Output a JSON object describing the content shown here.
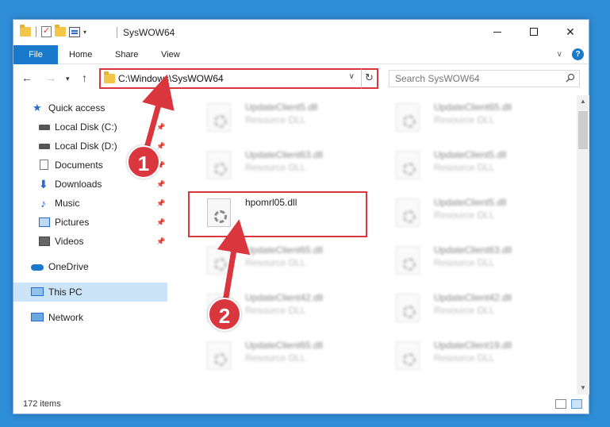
{
  "window": {
    "title": "SysWOW64"
  },
  "ribbon": {
    "tabs": [
      "File",
      "Home",
      "Share",
      "View"
    ],
    "help_label": "?"
  },
  "nav": {
    "address": "C:\\Windows\\SysWOW64",
    "search_placeholder": "Search SysWOW64"
  },
  "sidebar": {
    "items": [
      {
        "label": "Quick access",
        "icon": "star-icon"
      },
      {
        "label": "Local Disk (C:)",
        "icon": "drive-icon",
        "pinned": true
      },
      {
        "label": "Local Disk (D:)",
        "icon": "drive-icon",
        "pinned": true
      },
      {
        "label": "Documents",
        "icon": "documents-icon",
        "pinned": true
      },
      {
        "label": "Downloads",
        "icon": "download-icon",
        "pinned": true
      },
      {
        "label": "Music",
        "icon": "music-icon",
        "pinned": true
      },
      {
        "label": "Pictures",
        "icon": "pictures-icon",
        "pinned": true
      },
      {
        "label": "Videos",
        "icon": "videos-icon",
        "pinned": true
      },
      {
        "label": "OneDrive",
        "icon": "cloud-icon"
      },
      {
        "label": "This PC",
        "icon": "computer-icon",
        "selected": true
      },
      {
        "label": "Network",
        "icon": "network-icon"
      }
    ]
  },
  "files": [
    {
      "name": "UpdateClient5.dll",
      "type": "Resource DLL"
    },
    {
      "name": "UpdateClient65.dll",
      "type": "Resource DLL"
    },
    {
      "name": "UpdateClient63.dll",
      "type": "Resource DLL"
    },
    {
      "name": "UpdateClient5.dll",
      "type": "Resource DLL"
    },
    {
      "name": "hpomrl05.dll",
      "type": ""
    },
    {
      "name": "UpdateClient5.dll",
      "type": "Resource DLL"
    },
    {
      "name": "UpdateClient65.dll",
      "type": "Resource DLL"
    },
    {
      "name": "UpdateClient63.dll",
      "type": "Resource DLL"
    },
    {
      "name": "UpdateClient42.dll",
      "type": "Resource DLL"
    },
    {
      "name": "UpdateClient42.dll",
      "type": "Resource DLL"
    },
    {
      "name": "UpdateClient65.dll",
      "type": "Resource DLL"
    },
    {
      "name": "UpdateClient19.dll",
      "type": "Resource DLL"
    }
  ],
  "status": {
    "item_count": "172 items"
  },
  "annotations": {
    "step1": "1",
    "step2": "2",
    "color": "#d9363e"
  }
}
